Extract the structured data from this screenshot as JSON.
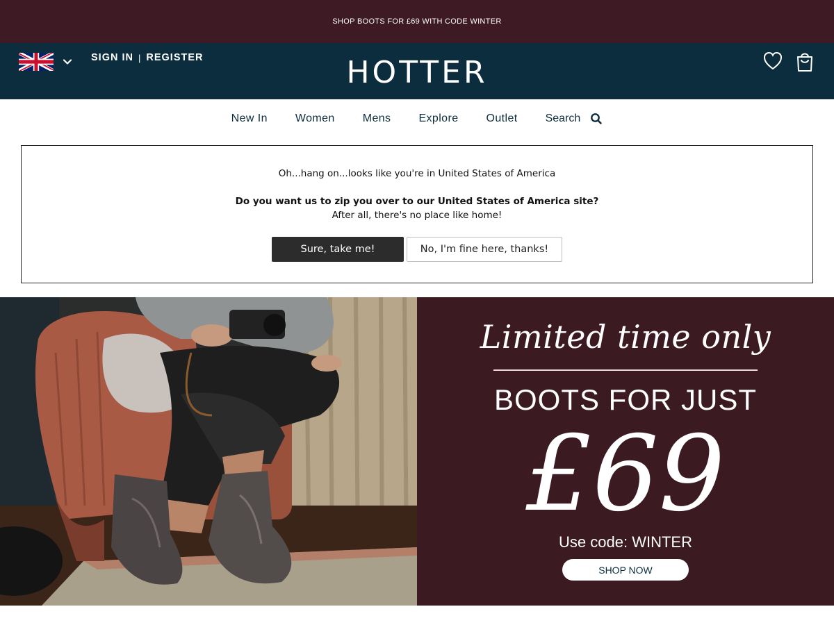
{
  "promo_bar": {
    "text": "SHOP BOOTS FOR £69 WITH CODE WINTER"
  },
  "header": {
    "country_flag_icon": "uk-flag-icon",
    "sign_in_label": "SIGN IN",
    "separator": "|",
    "register_label": "REGISTER",
    "logo_text": "HOTTER",
    "icons": [
      "heart-icon",
      "shopping-bag-icon"
    ]
  },
  "nav": {
    "items": [
      {
        "label": "New In"
      },
      {
        "label": "Women"
      },
      {
        "label": "Mens"
      },
      {
        "label": "Explore"
      },
      {
        "label": "Outlet"
      }
    ],
    "search_label": "Search",
    "search_icon": "search-icon"
  },
  "geo_prompt": {
    "line1": "Oh...hang on...looks like you're in United States of America",
    "line2": "Do you want us to zip you over to our United States of America site?",
    "line3": "After all, there's no place like home!",
    "accept_label": "Sure, take me!",
    "decline_label": "No, I'm fine here, thanks!"
  },
  "hero": {
    "tagline": "Limited time only",
    "headline": "BOOTS FOR JUST",
    "price": "£69",
    "code_text": "Use code: WINTER",
    "cta_label": "SHOP NOW"
  },
  "colors": {
    "promo_bg": "#3d1a24",
    "header_bg": "#0c2d3d",
    "hero_panel_bg": "#3c1a22",
    "primary_button": "#2c2c2c"
  }
}
